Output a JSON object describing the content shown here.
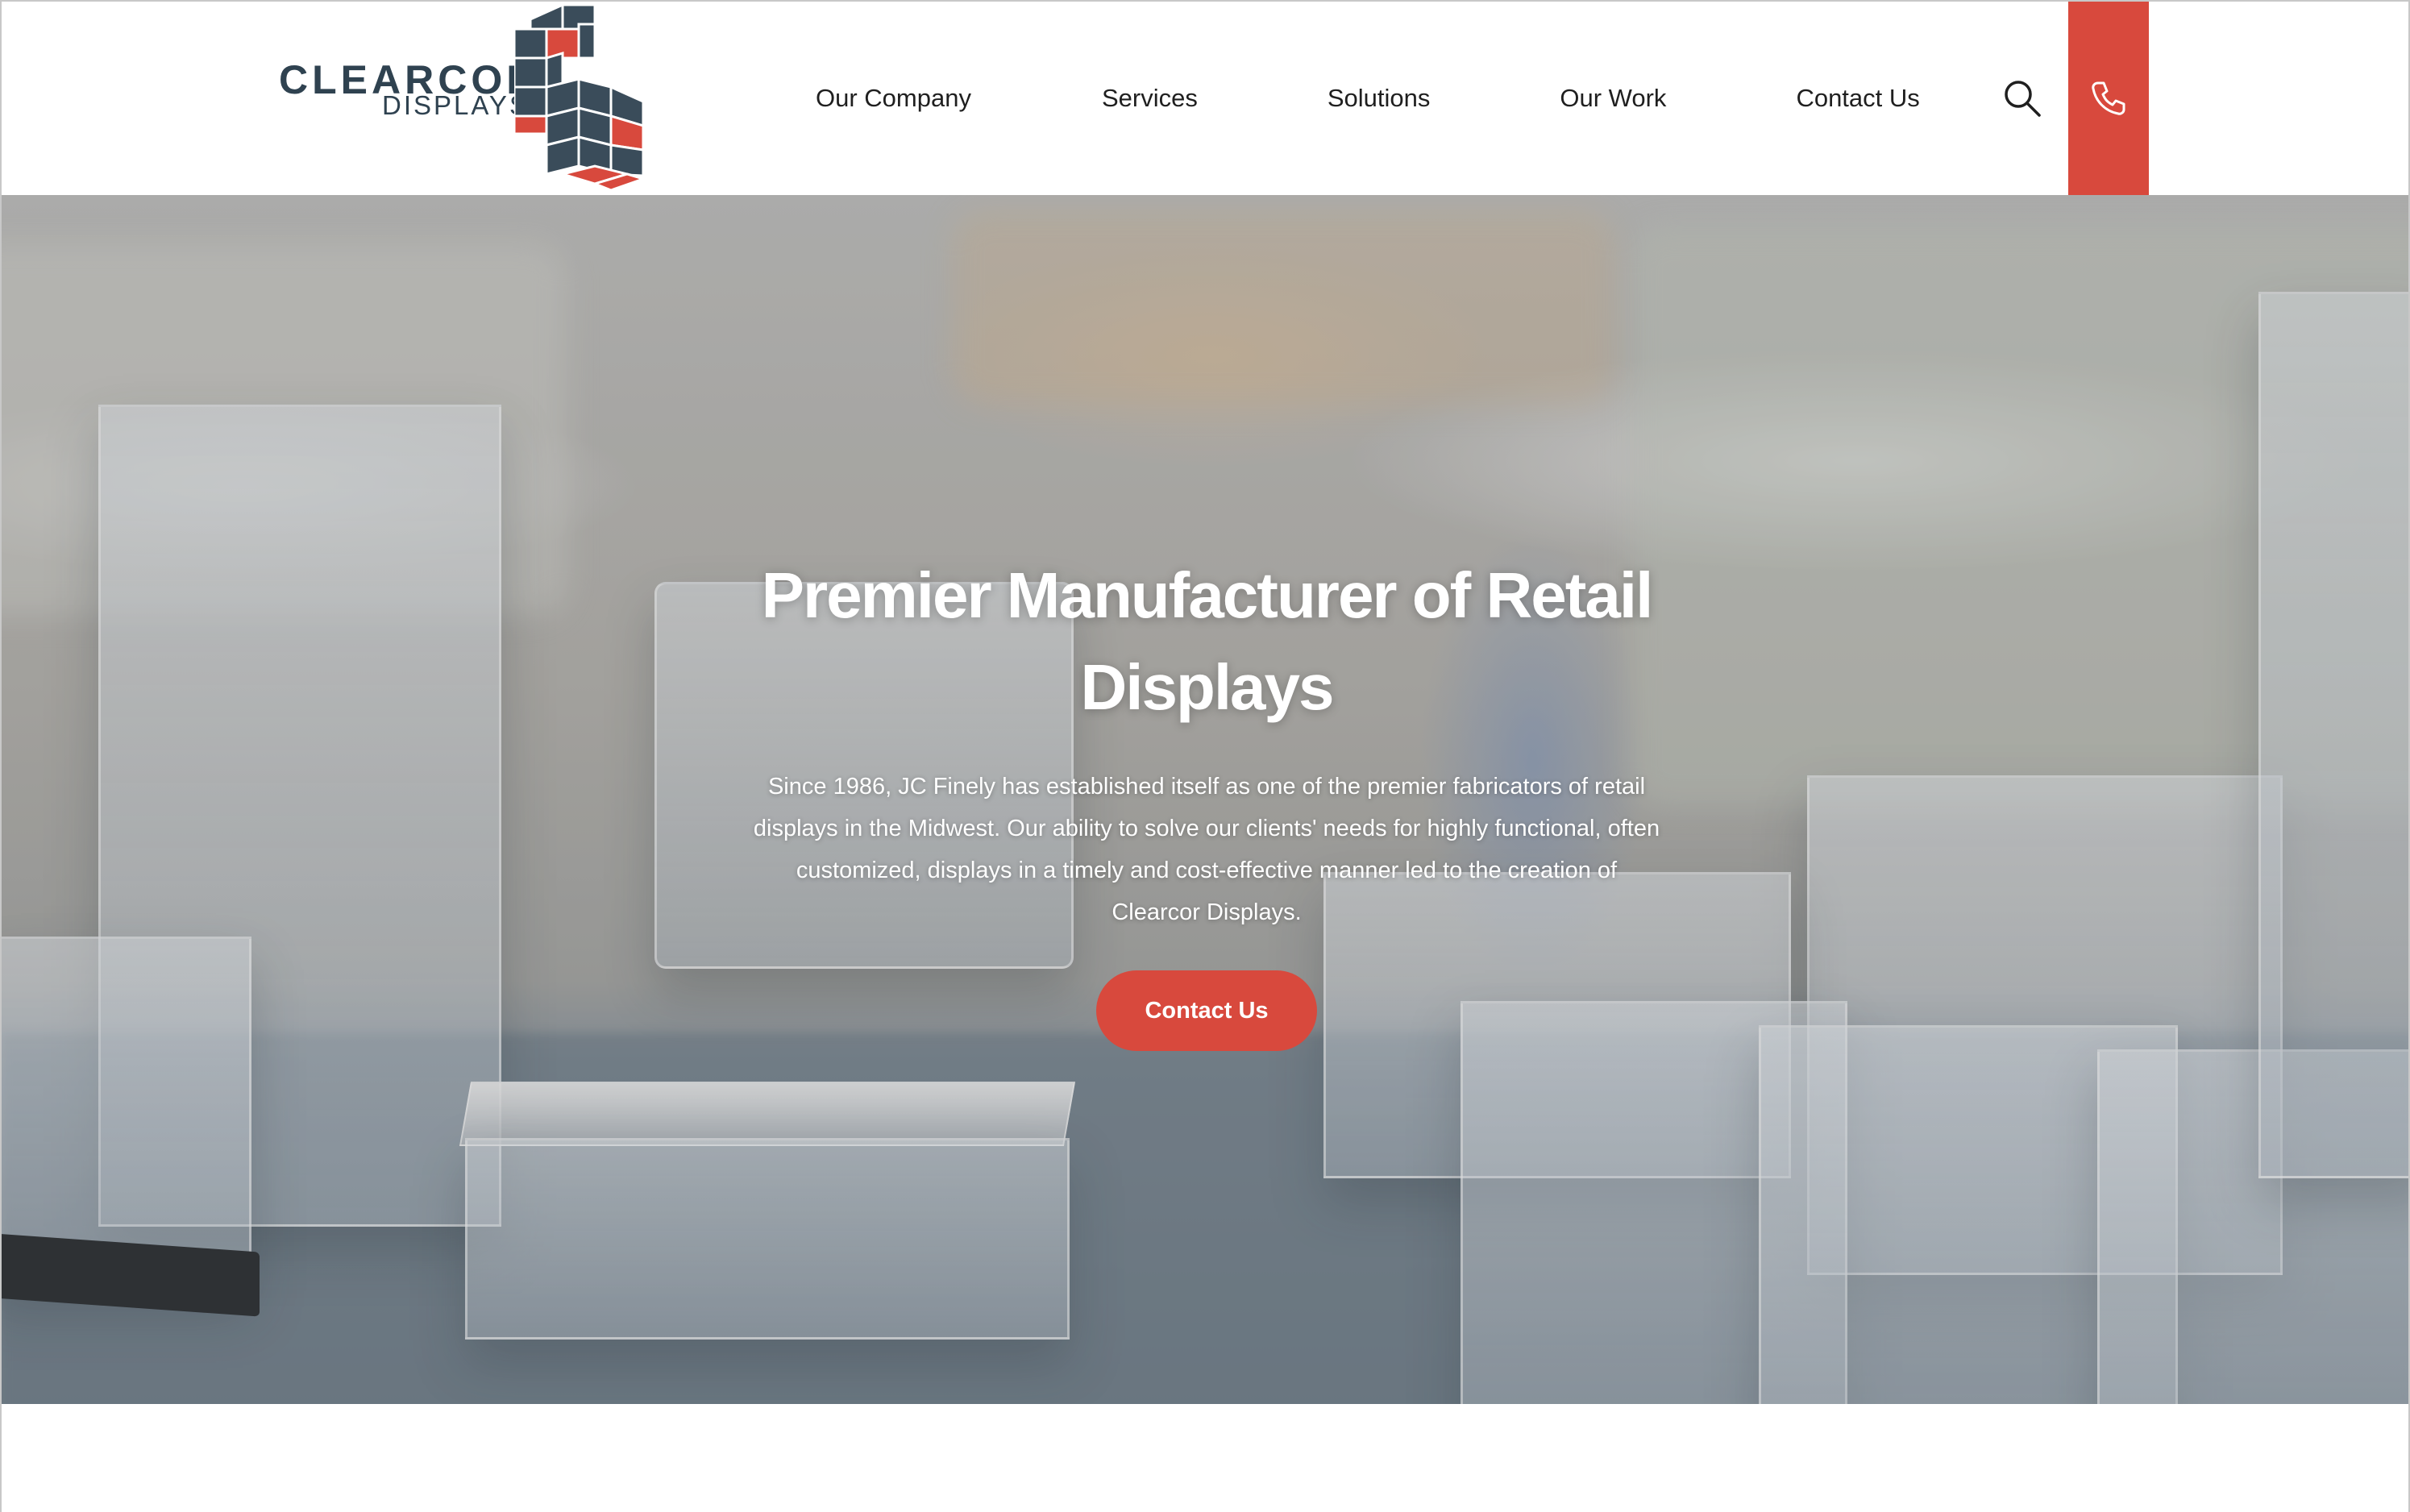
{
  "brand": {
    "line1": "CLEARCOR",
    "line2": "DISPLAYS",
    "colors": {
      "navy": "#2f4250",
      "red": "#d8493d"
    }
  },
  "nav": {
    "items": [
      {
        "label": "Our Company"
      },
      {
        "label": "Services"
      },
      {
        "label": "Solutions"
      },
      {
        "label": "Our Work"
      },
      {
        "label": "Contact Us"
      }
    ],
    "search_icon": "search-icon",
    "phone_icon": "phone-icon"
  },
  "hero": {
    "title": "Premier Manufacturer of Retail Displays",
    "text": "Since 1986, JC Finely has established itself as one of the premier fabricators of retail displays in the Midwest.  Our ability to solve our clients' needs for highly functional, often customized, displays in a timely and cost-effective manner led to the creation of Clearcor Displays.",
    "cta_label": "Contact Us",
    "accent": "#d8493d"
  }
}
